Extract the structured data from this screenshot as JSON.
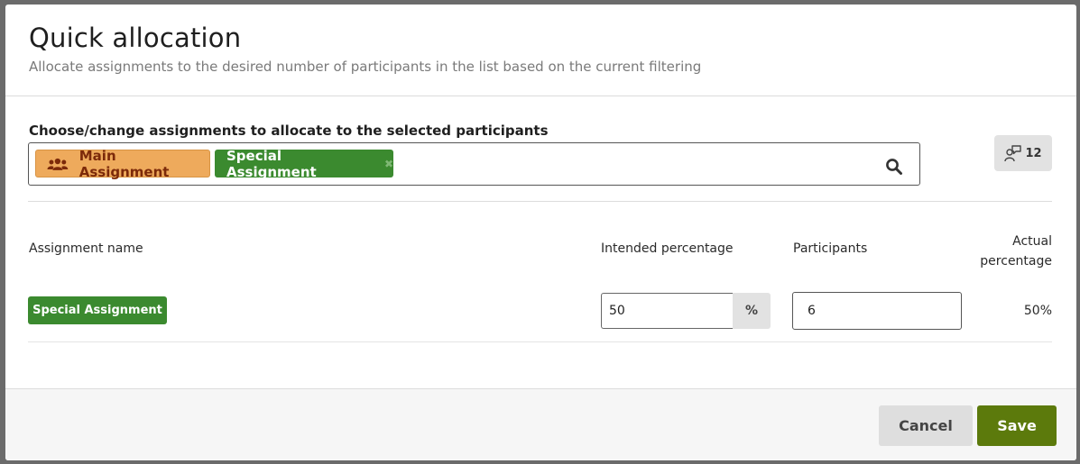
{
  "dialog": {
    "title": "Quick allocation",
    "subtitle": "Allocate assignments to the desired number of participants in the list based on the current filtering"
  },
  "assignment_picker": {
    "label": "Choose/change assignments to allocate to the selected participants",
    "chips": [
      {
        "label": "Main Assignment",
        "icon": "group-icon",
        "color": "#eeaa5c"
      },
      {
        "label": "Special Assignment",
        "remove_icon": "close-icon",
        "color": "#3b8a2f"
      }
    ],
    "search_icon": "search-icon"
  },
  "counter": {
    "icon": "person-speech-icon",
    "value": "12"
  },
  "table": {
    "headers": {
      "name": "Assignment name",
      "intended": "Intended percentage",
      "participants": "Participants",
      "actual": "Actual percentage"
    },
    "rows": [
      {
        "name": "Special Assignment",
        "intended_percentage": "50",
        "unit": "%",
        "participants": "6",
        "actual_percentage": "50%"
      }
    ]
  },
  "footer": {
    "cancel_label": "Cancel",
    "save_label": "Save"
  },
  "colors": {
    "save": "#5c7a0c",
    "special_assignment": "#3b8a2f",
    "main_assignment": "#eeaa5c"
  }
}
